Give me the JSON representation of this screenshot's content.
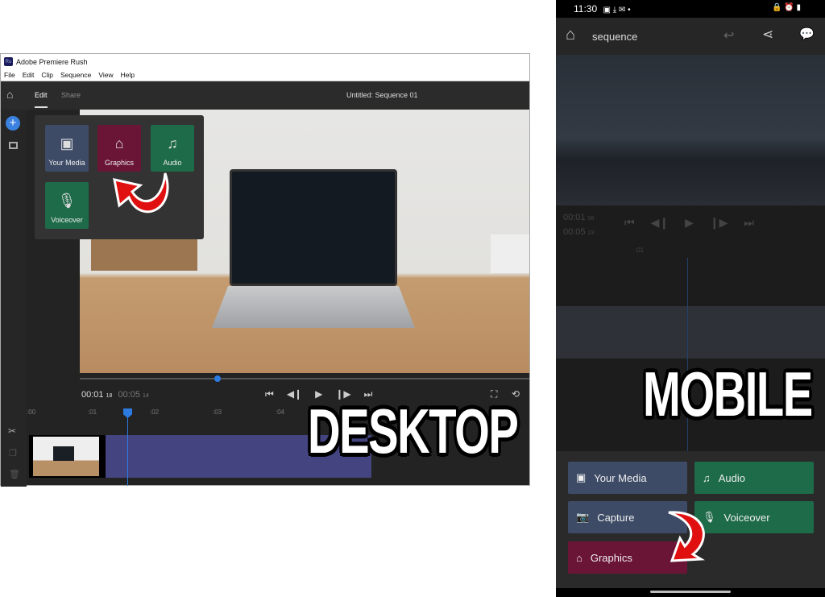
{
  "desktop": {
    "window_title": "Adobe Premiere Rush",
    "logo_text": "Ru",
    "menu": [
      "File",
      "Edit",
      "Clip",
      "Sequence",
      "View",
      "Help"
    ],
    "tabs": [
      {
        "label": "Edit",
        "active": true
      },
      {
        "label": "Share",
        "active": false
      }
    ],
    "sequence_title": "Untitled: Sequence 01",
    "add_panel": [
      {
        "label": "Your Media",
        "icon": "media-icon",
        "color": "#3d4b66"
      },
      {
        "label": "Graphics",
        "icon": "graphics-icon",
        "color": "#6b1536"
      },
      {
        "label": "Audio",
        "icon": "music-note-icon",
        "color": "#1d6b48"
      },
      {
        "label": "Voiceover",
        "icon": "microphone-icon",
        "color": "#1d6b48"
      }
    ],
    "current_time": "00:01",
    "current_frames": "18",
    "duration": "00:05",
    "duration_frames": "14",
    "ruler": [
      ":00",
      ":01",
      ":02",
      ":03",
      ":04"
    ],
    "accent": "#2d7be0"
  },
  "mobile": {
    "status_time": "11:30",
    "app_title": "sequence",
    "current_time": "00:01",
    "current_frames": "08",
    "duration": "00:05",
    "duration_frames": "23",
    "ruler": [
      ":01"
    ],
    "buttons": [
      {
        "label": "Your Media",
        "icon": "media-icon",
        "color": "#3d4b66"
      },
      {
        "label": "Audio",
        "icon": "music-note-icon",
        "color": "#1d6b48"
      },
      {
        "label": "Capture",
        "icon": "camera-icon",
        "color": "#3d4b66"
      },
      {
        "label": "Voiceover",
        "icon": "microphone-icon",
        "color": "#1d6b48"
      },
      {
        "label": "Graphics",
        "icon": "graphics-icon",
        "color": "#6b1536"
      }
    ]
  },
  "labels": {
    "desktop": "DESKTOP",
    "mobile": "MOBILE"
  }
}
